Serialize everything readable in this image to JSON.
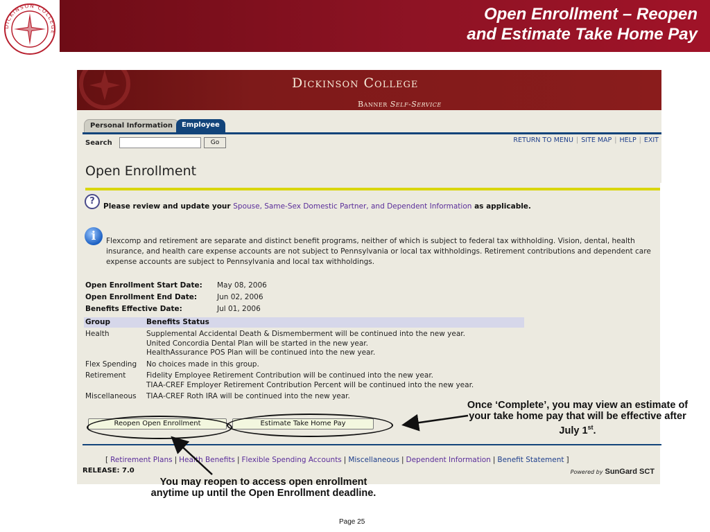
{
  "slide": {
    "title_line1": "Open Enrollment – Reopen",
    "title_line2": "and Estimate Take Home Pay",
    "seal_text": "DICKINSON COLLEGE",
    "page_number": "Page 25",
    "colors": {
      "brand_red": "#8e1324",
      "banner_red": "#7e1a1a",
      "nav_blue": "#12447a",
      "accent_yellow": "#d9d60d"
    }
  },
  "app": {
    "banner_title": "Dickinson College",
    "banner_sub_plain": "Banner",
    "banner_sub_italic": "Self-Service",
    "tabs": [
      {
        "label": "Personal Information",
        "active": false
      },
      {
        "label": "Employee",
        "active": true
      }
    ],
    "search": {
      "label": "Search",
      "value": "",
      "go_label": "Go"
    },
    "nav_links": [
      "RETURN TO MENU",
      "SITE MAP",
      "HELP",
      "EXIT"
    ]
  },
  "page": {
    "title": "Open Enrollment",
    "review_prefix": "Please review and update your ",
    "review_link": "Spouse, Same-Sex Domestic Partner, and Dependent Information",
    "review_suffix": " as applicable.",
    "info": "Flexcomp and retirement are separate and distinct benefit programs, neither of which is subject to federal tax withholding. Vision, dental, health insurance, and health care expense accounts are not subject to Pennsylvania or local tax withholdings. Retirement contributions and dependent care expense accounts are subject to Pennsylvania and local tax withholdings.",
    "dates": [
      {
        "label": "Open Enrollment Start Date:",
        "value": "May 08, 2006"
      },
      {
        "label": "Open Enrollment End Date:",
        "value": "Jun 02, 2006"
      },
      {
        "label": "Benefits Effective Date:",
        "value": "Jul 01, 2006"
      }
    ],
    "benefits_table": {
      "headers": [
        "Group",
        "Benefits Status"
      ],
      "rows": [
        {
          "group": "Health",
          "status": [
            "Supplemental Accidental Death & Dismemberment will be continued into the new year.",
            "United Concordia Dental Plan will be started in the new year.",
            "HealthAssurance POS Plan will be continued into the new year."
          ]
        },
        {
          "group": "Flex Spending",
          "status": [
            "No choices made in this group."
          ]
        },
        {
          "group": "Retirement",
          "status": [
            "Fidelity Employee Retirement Contribution will be continued into the new year.",
            "TIAA-CREF Employer Retirement Contribution Percent will be continued into the new year."
          ]
        },
        {
          "group": "Miscellaneous",
          "status": [
            "TIAA-CREF Roth IRA will be continued into the new year."
          ]
        }
      ]
    },
    "buttons": {
      "reopen": "Reopen Open Enrollment",
      "estimate": "Estimate Take Home Pay"
    },
    "bottom_links": [
      "Retirement Plans",
      "Health Benefits",
      "Flexible Spending Accounts",
      "Miscellaneous",
      "Dependent Information",
      "Benefit Statement"
    ],
    "release": "RELEASE: 7.0",
    "powered_by": "Powered by",
    "powered_brand": "SunGard SCT"
  },
  "annotations": {
    "right_text": "Once ‘Complete’, you may view an estimate of your take home pay that will be effective after July 1",
    "right_sup": "st",
    "right_end": ".",
    "bottom_text": "You may reopen to access open enrollment anytime up until the Open Enrollment deadline."
  }
}
